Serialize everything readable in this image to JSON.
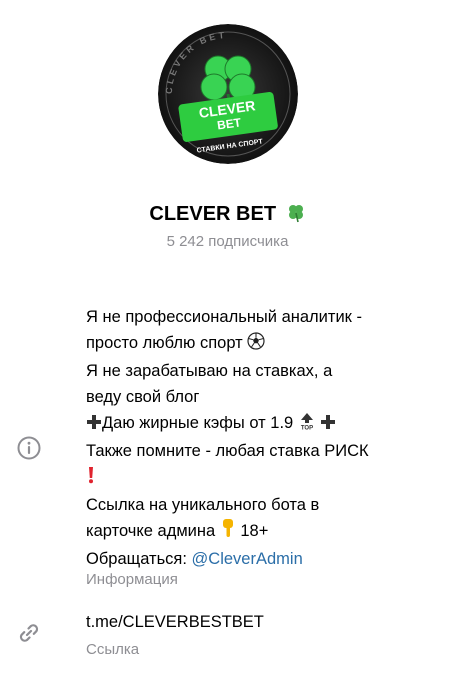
{
  "channel": {
    "name": "CLEVER BET",
    "subscribers": "5 242 подписчика",
    "avatar_text": {
      "brand_top": "CLEVER",
      "brand_bottom": "BET",
      "tagline": "СТАВКИ НА СПОРТ",
      "ring_text": "CLEVER BET"
    }
  },
  "info": {
    "description_lines": [
      "Я не профессиональный аналитик -",
      "просто люблю спорт",
      "Я не зарабатываю на ставках, а",
      "веду свой блог",
      "Даю жирные кэфы от 1.9",
      "Также помните - любая ставка РИСК",
      "Ссылка на уникального бота в",
      "карточке админа",
      "18+",
      "Обращаться:",
      "@CleverAdmin"
    ],
    "label": "Информация"
  },
  "link": {
    "value": "t.me/CLEVERBESTBET",
    "label": "Ссылка"
  },
  "icons": {
    "info": "info-circle-icon",
    "link": "link-chain-icon",
    "title_emoji": "four-leaf-clover-icon",
    "soccer": "soccer-ball-icon",
    "plus": "heavy-plus-icon",
    "top": "top-arrow-icon",
    "exclamation": "red-exclamation-icon",
    "hand": "pointing-down-hand-icon"
  },
  "colors": {
    "link": "#2b6ea8",
    "secondary_text": "#8e8e93",
    "brand_green": "#2ecc40"
  }
}
